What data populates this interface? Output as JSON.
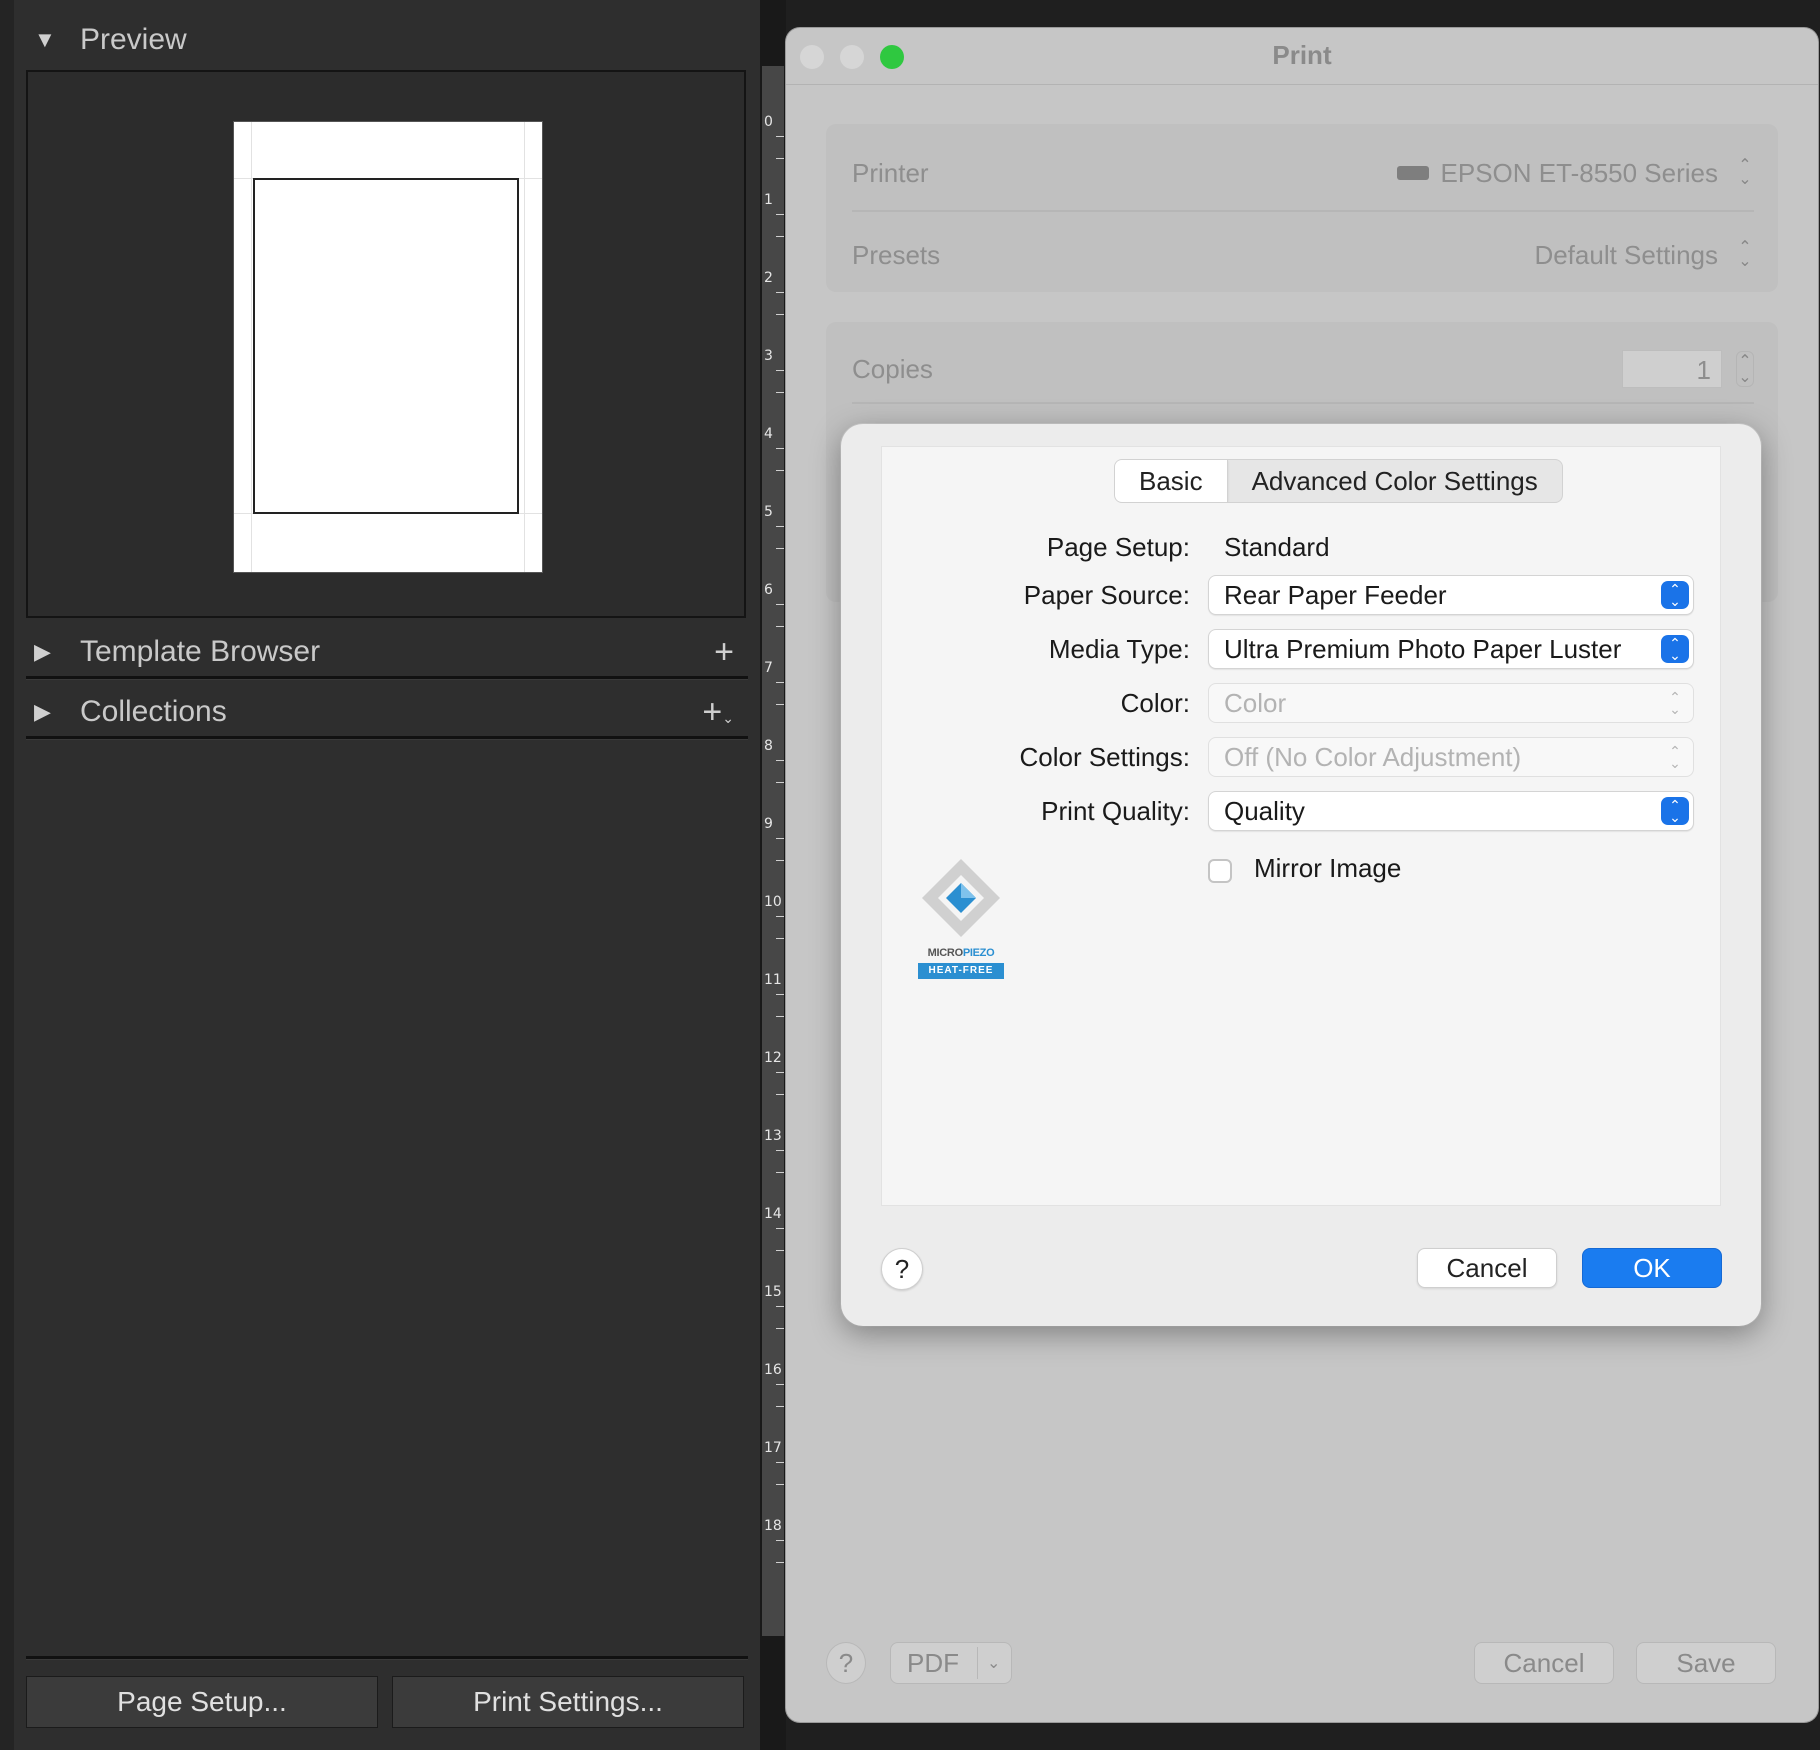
{
  "left_panel": {
    "preview_header": "Preview",
    "template_browser_header": "Template Browser",
    "collections_header": "Collections",
    "page_setup_button": "Page Setup...",
    "print_settings_button": "Print Settings..."
  },
  "ruler": {
    "numbers": [
      "0",
      "1",
      "2",
      "3",
      "4",
      "5",
      "6",
      "7",
      "8",
      "9",
      "10",
      "11",
      "12",
      "13",
      "14",
      "15",
      "16",
      "17",
      "18"
    ]
  },
  "print_window": {
    "title": "Print",
    "printer_label": "Printer",
    "printer_value": "EPSON ET-8550 Series",
    "presets_label": "Presets",
    "presets_value": "Default Settings",
    "copies_label": "Copies",
    "copies_value": "1",
    "help_label": "?",
    "pdf_label": "PDF",
    "cancel_label": "Cancel",
    "save_label": "Save"
  },
  "sheet": {
    "tabs": [
      "Basic",
      "Advanced Color Settings"
    ],
    "page_setup_label": "Page Setup:",
    "page_setup_value": "Standard",
    "paper_source_label": "Paper Source:",
    "paper_source_value": "Rear Paper Feeder",
    "media_type_label": "Media Type:",
    "media_type_value": "Ultra Premium Photo Paper Luster",
    "color_label": "Color:",
    "color_value": "Color",
    "color_settings_label": "Color Settings:",
    "color_settings_value": "Off (No Color Adjustment)",
    "print_quality_label": "Print Quality:",
    "print_quality_value": "Quality",
    "mirror_label": "Mirror Image",
    "mirror_checked": false,
    "logo_text_1": "MICRO",
    "logo_text_2": "PIEZO",
    "logo_text_3": "HEAT-FREE",
    "help_label": "?",
    "cancel_label": "Cancel",
    "ok_label": "OK"
  },
  "colors": {
    "accent": "#1a7cf0",
    "traffic_close": "#d6d6d6",
    "traffic_min": "#d6d6d6",
    "traffic_zoom": "#2fc840"
  }
}
